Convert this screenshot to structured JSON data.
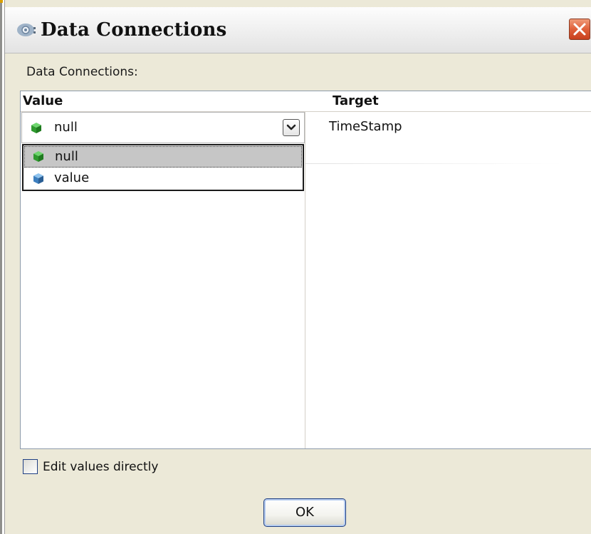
{
  "window": {
    "title": "Data Connections",
    "title_icon": "gear-icon",
    "close_icon": "close-icon",
    "accent_color": "#e0603a"
  },
  "section_label": "Data Connections:",
  "table": {
    "columns": [
      "Value",
      "Target"
    ],
    "rows": [
      {
        "value": "null",
        "value_icon": "green-cube-icon",
        "target": "TimeStamp"
      }
    ]
  },
  "dropdown": {
    "selected": "null",
    "options": [
      {
        "label": "null",
        "icon": "green-cube-icon",
        "color": "#2f9a2f"
      },
      {
        "label": "value",
        "icon": "blue-cube-icon",
        "color": "#3d7fbf"
      }
    ]
  },
  "checkbox": {
    "label": "Edit values directly",
    "checked": false
  },
  "ok_label": "OK"
}
